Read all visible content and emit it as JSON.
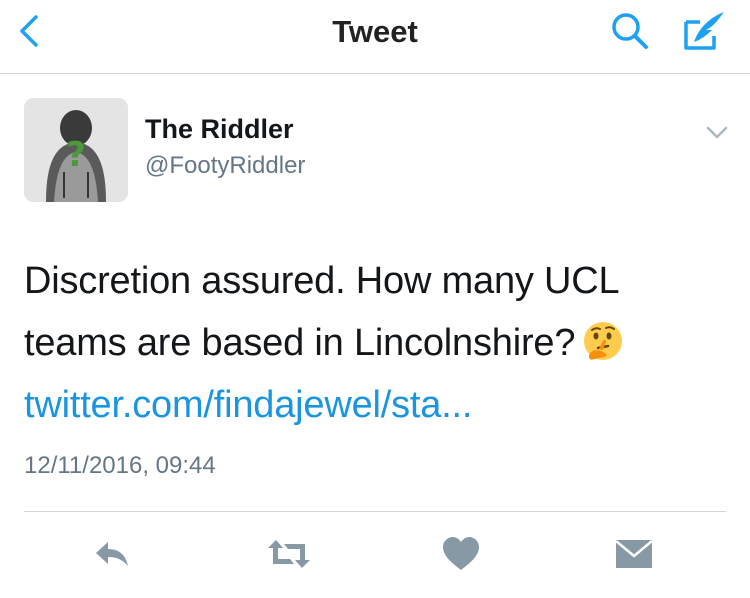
{
  "header": {
    "title": "Tweet",
    "back_icon": "chevron-left-icon",
    "search_icon": "search-icon",
    "compose_icon": "compose-quill-icon",
    "accent_color": "#1da1f2"
  },
  "tweet": {
    "author_name": "The Riddler",
    "author_handle": "@FootyRiddler",
    "avatar_icon": "riddler-avatar",
    "text_line1": "Discretion assured. How many UCL",
    "text_line2": "teams are based in Lincolnshire?",
    "emoji": "thinking-face-emoji",
    "link_text": "twitter.com/findajewel/sta...",
    "timestamp": "12/11/2016, 09:44",
    "text_color": "#14171a",
    "link_color": "#1b95e0",
    "meta_color": "#657786"
  },
  "actions": {
    "reply_icon": "reply-icon",
    "retweet_icon": "retweet-icon",
    "like_icon": "heart-icon",
    "dm_icon": "envelope-icon",
    "icon_color": "#8899a6"
  }
}
